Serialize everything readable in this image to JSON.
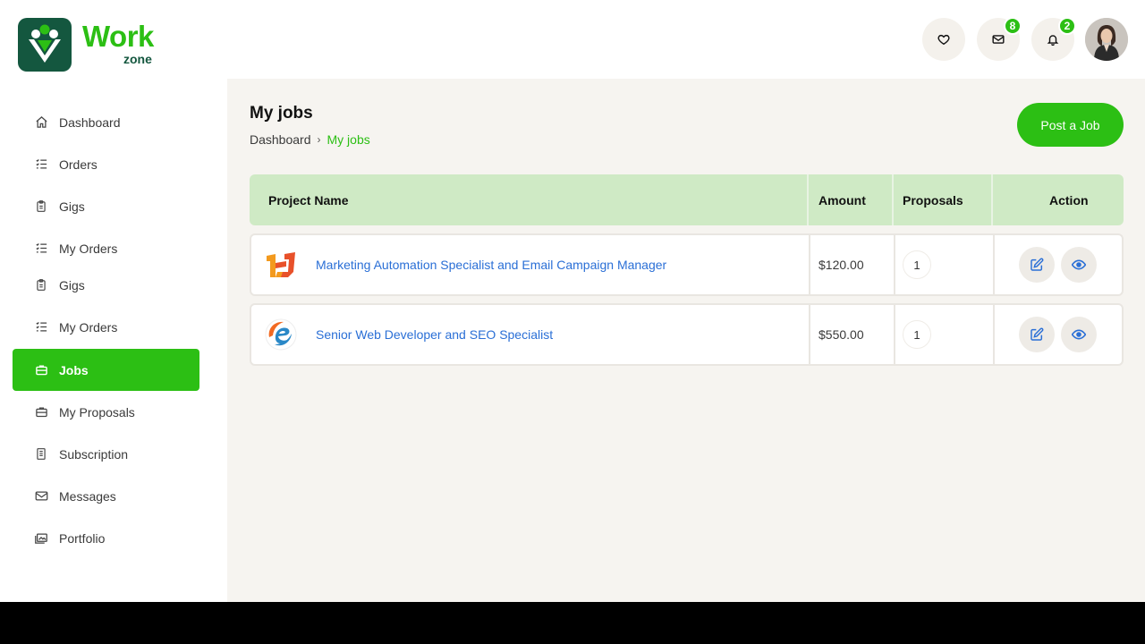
{
  "brand": {
    "name": "Work",
    "sub": "zone"
  },
  "header": {
    "messages_count": "8",
    "notifications_count": "2"
  },
  "sidebar": {
    "items": [
      {
        "label": "Dashboard",
        "icon": "home-icon"
      },
      {
        "label": "Orders",
        "icon": "list-icon"
      },
      {
        "label": "Gigs",
        "icon": "clipboard-icon"
      },
      {
        "label": "My Orders",
        "icon": "list-icon"
      },
      {
        "label": "Gigs",
        "icon": "clipboard-icon"
      },
      {
        "label": "My Orders",
        "icon": "list-icon"
      },
      {
        "label": "Jobs",
        "icon": "briefcase-icon",
        "active": true
      },
      {
        "label": "My Proposals",
        "icon": "briefcase-icon"
      },
      {
        "label": "Subscription",
        "icon": "receipt-icon"
      },
      {
        "label": "Messages",
        "icon": "envelope-icon"
      },
      {
        "label": "Portfolio",
        "icon": "images-icon"
      }
    ]
  },
  "page": {
    "title": "My jobs",
    "breadcrumb": {
      "root": "Dashboard",
      "current": "My jobs"
    },
    "post_button": "Post a Job"
  },
  "table": {
    "headers": {
      "project": "Project Name",
      "amount": "Amount",
      "proposals": "Proposals",
      "action": "Action"
    },
    "rows": [
      {
        "title": "Marketing Automation Specialist and Email Campaign Manager",
        "amount": "$120.00",
        "proposals": "1",
        "logo": "hj-logo-icon"
      },
      {
        "title": "Senior Web Developer and SEO Specialist",
        "amount": "$550.00",
        "proposals": "1",
        "logo": "e-logo-icon"
      }
    ]
  },
  "colors": {
    "accent": "#2cbf14",
    "brand_dark": "#14573f",
    "table_header": "#cfeac5",
    "link": "#2a6fd6"
  }
}
